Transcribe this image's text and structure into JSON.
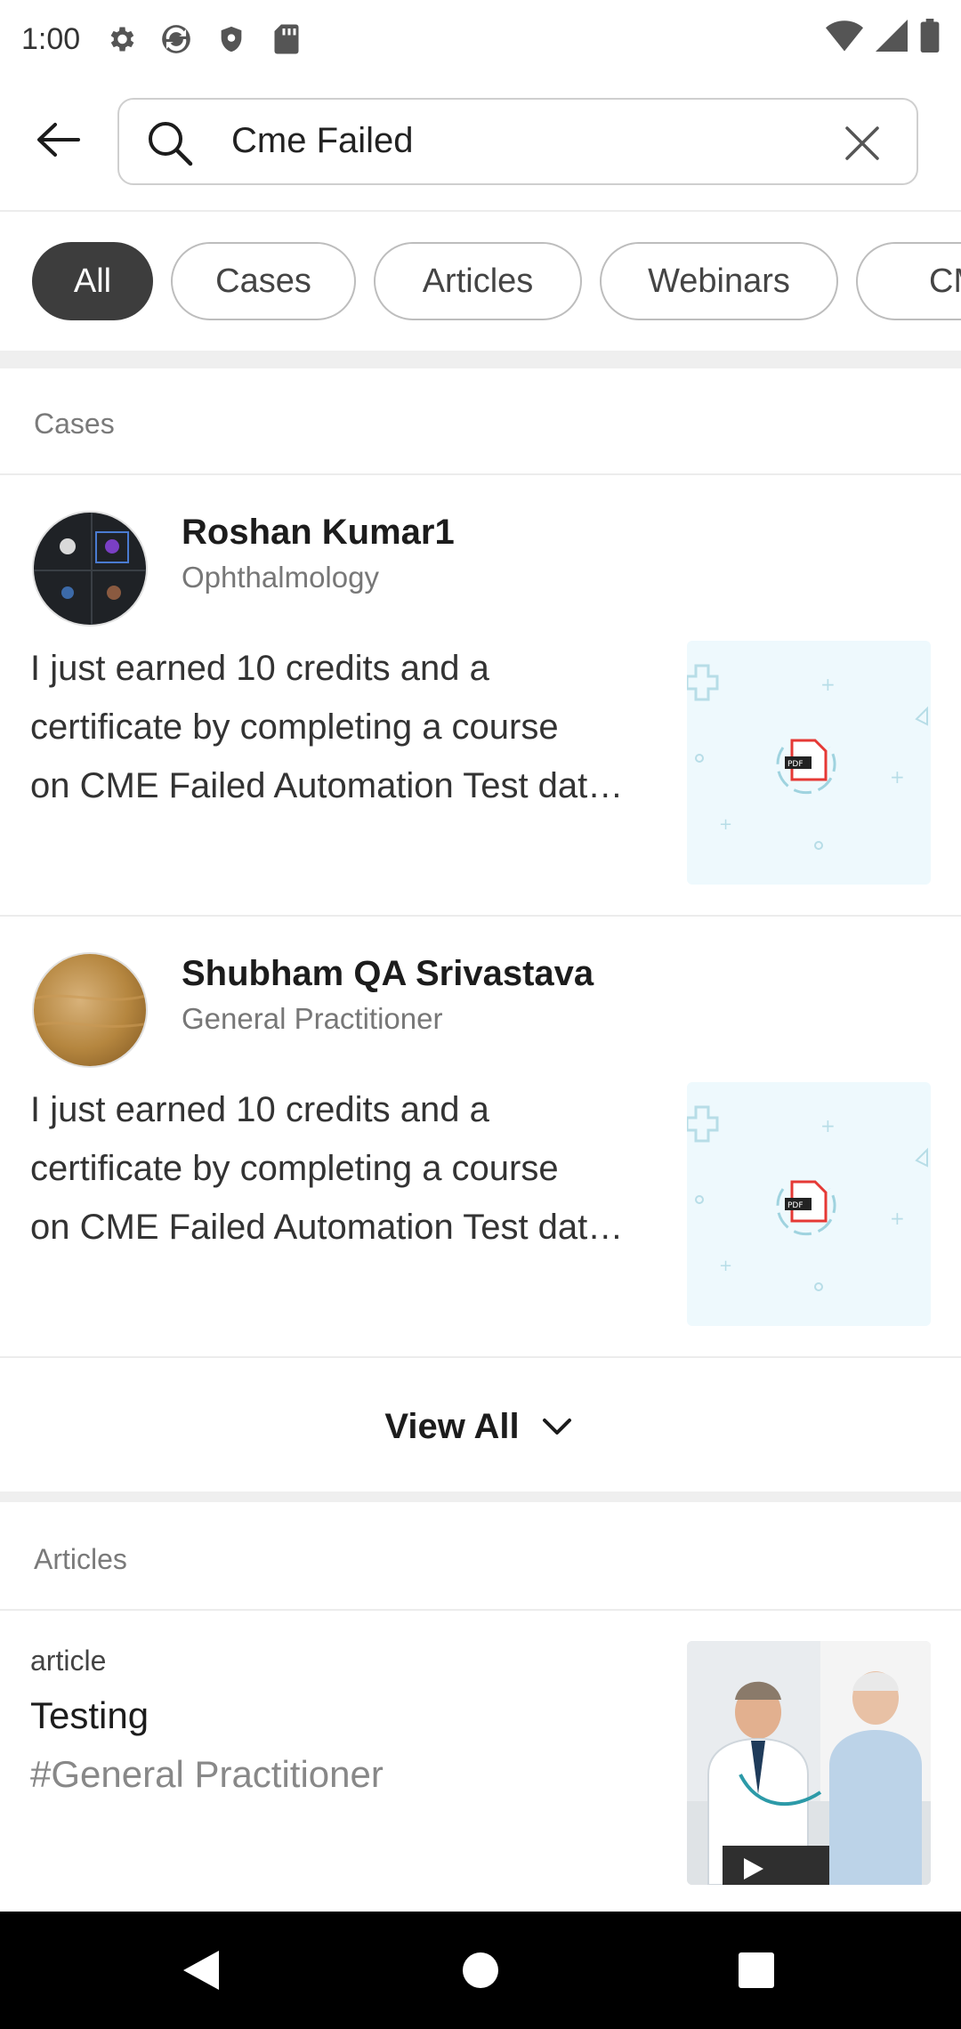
{
  "status_bar": {
    "time": "1:00",
    "left_icons": [
      "gear-icon",
      "sync-icon",
      "shield-icon",
      "sdcard-icon"
    ],
    "right_icons": [
      "wifi-icon",
      "signal-icon",
      "battery-icon"
    ]
  },
  "search": {
    "query": "Cme Failed"
  },
  "filter_chips": [
    {
      "label": "All",
      "active": true
    },
    {
      "label": "Cases",
      "active": false
    },
    {
      "label": "Articles",
      "active": false
    },
    {
      "label": "Webinars",
      "active": false
    },
    {
      "label": "CME",
      "active": false
    }
  ],
  "cases_section": {
    "header": "Cases",
    "items": [
      {
        "author": "Roshan Kumar1",
        "specialty": "Ophthalmology",
        "text_lines": [
          "I just earned 10 credits and a",
          "certificate by completing a course",
          "on CME Failed Automation Test dat…"
        ],
        "thumb_icon": "pdf-icon"
      },
      {
        "author": "Shubham QA Srivastava",
        "specialty": "General Practitioner",
        "text_lines": [
          "I just earned 10 credits and a",
          "certificate by completing a course",
          "on CME Failed Automation Test dat…"
        ],
        "thumb_icon": "pdf-icon"
      }
    ],
    "view_all_label": "View All"
  },
  "articles_section": {
    "header": "Articles",
    "items": [
      {
        "type": "article",
        "title": "Testing",
        "tag": "#General Practitioner"
      }
    ]
  },
  "colors": {
    "chip_active_bg": "#3d3d3d",
    "thumb_bg": "#eef9fd",
    "pdf_red": "#e53935"
  }
}
